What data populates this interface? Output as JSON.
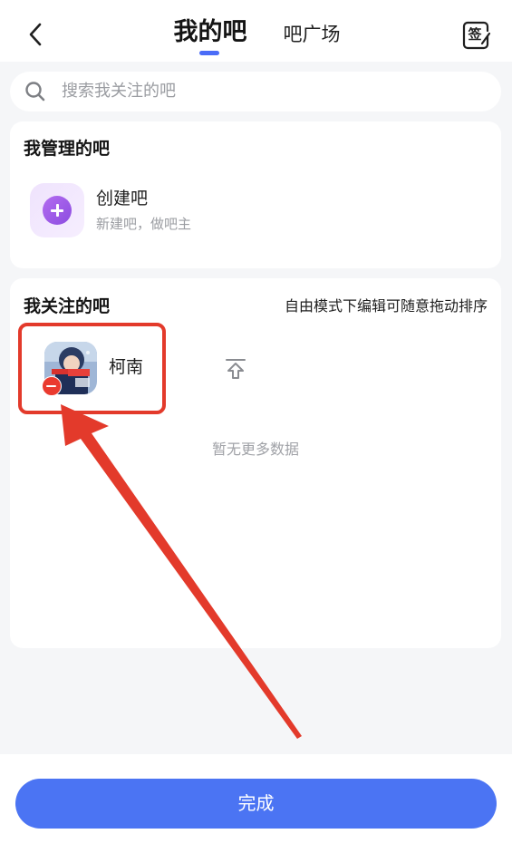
{
  "header": {
    "tab_mine": "我的吧",
    "tab_square": "吧广场",
    "sign_label": "签"
  },
  "search": {
    "placeholder": "搜索我关注的吧"
  },
  "managed": {
    "title": "我管理的吧",
    "create_title": "创建吧",
    "create_subtitle": "新建吧，做吧主"
  },
  "followed": {
    "title": "我关注的吧",
    "hint": "自由模式下编辑可随意拖动排序",
    "items": [
      {
        "name": "柯南",
        "avatar_caption": "柯南"
      }
    ],
    "empty_text": "暂无更多数据"
  },
  "footer": {
    "done_label": "完成"
  },
  "colors": {
    "accent": "#4b74f3",
    "highlight": "#e33a2b",
    "create_icon": "#9a57e8"
  }
}
